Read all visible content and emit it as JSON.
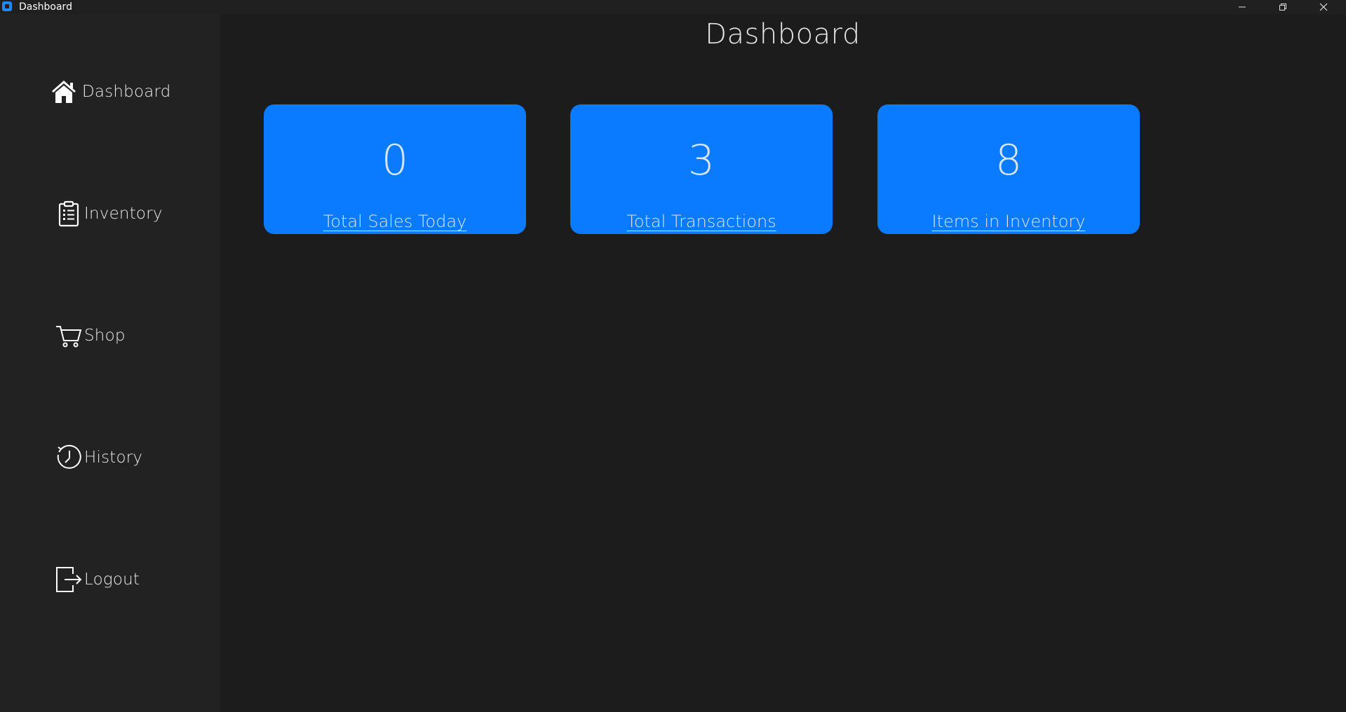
{
  "window": {
    "title": "Dashboard",
    "controls": [
      "minimize-icon",
      "restore-icon",
      "close-icon"
    ]
  },
  "sidebar": {
    "items": [
      {
        "label": "Dashboard",
        "icon": "home-icon"
      },
      {
        "label": "Inventory",
        "icon": "clipboard-icon"
      },
      {
        "label": "Shop",
        "icon": "cart-icon"
      },
      {
        "label": "History",
        "icon": "history-icon"
      },
      {
        "label": "Logout",
        "icon": "logout-icon"
      }
    ]
  },
  "main": {
    "title": "Dashboard",
    "cards": [
      {
        "value": "0",
        "label": "Total Sales Today"
      },
      {
        "value": "3",
        "label": "Total Transactions"
      },
      {
        "value": "8",
        "label": "Items in Inventory"
      }
    ]
  },
  "colors": {
    "background": "#1c1c1c",
    "sidebar": "#222222",
    "card": "#0a7bff",
    "text": "#e6e6e6"
  }
}
